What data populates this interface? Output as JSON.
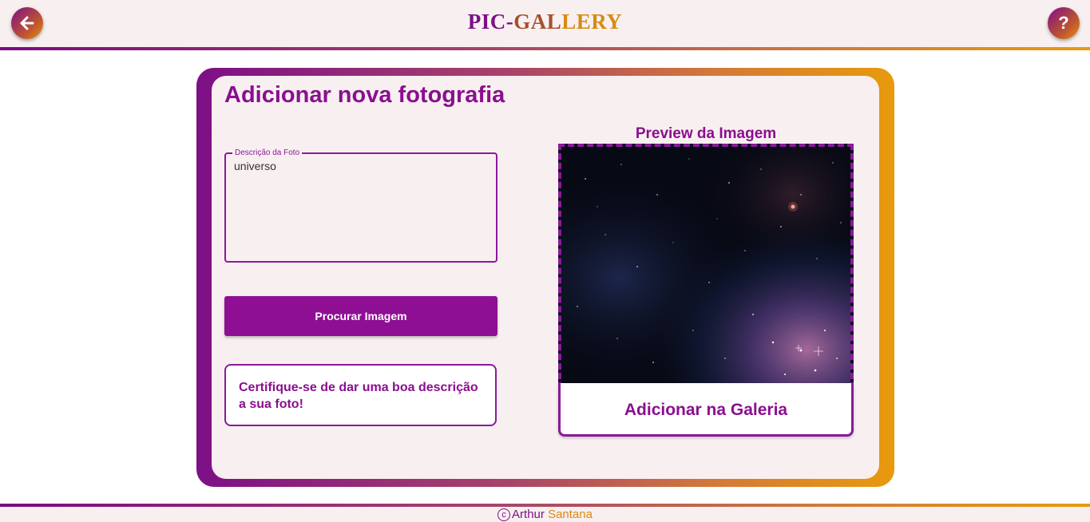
{
  "header": {
    "brand_part1": "PIC-",
    "brand_part2": "GAL",
    "brand_part3": "LERY",
    "back_icon": "arrow-left-icon",
    "help_label": "?"
  },
  "form": {
    "title": "Adicionar nova fotografia",
    "description_legend": "Descrição da Foto",
    "description_value": "universo",
    "search_button": "Procurar Imagem",
    "tip": "Certifique-se de dar uma boa descrição a sua foto!"
  },
  "preview": {
    "label": "Preview da Imagem",
    "add_button": "Adicionar na Galeria"
  },
  "footer": {
    "copyright_symbol": "c",
    "author_first": "Arthur ",
    "author_last": "Santana"
  },
  "colors": {
    "primary": "#8a0f8f",
    "accent": "#e89a10",
    "panel_bg": "#f8f0f0"
  }
}
